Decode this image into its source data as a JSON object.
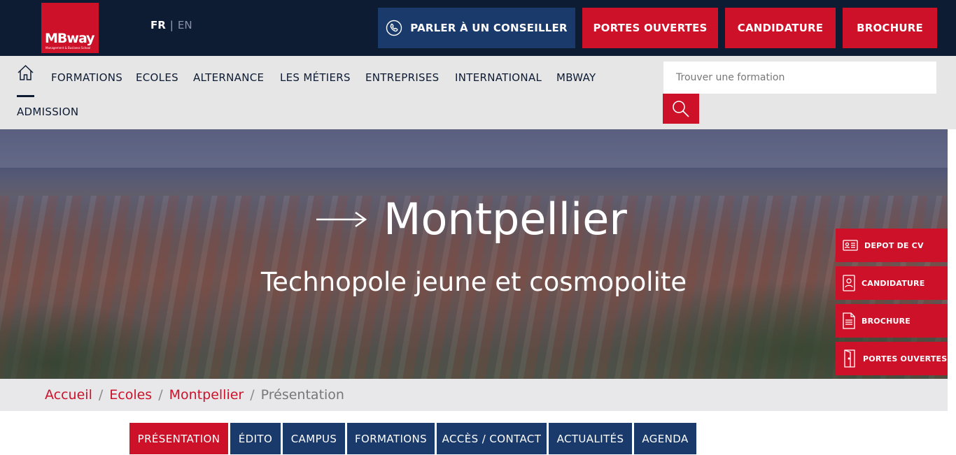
{
  "header": {
    "logo_text": "MBway",
    "logo_tagline": "Management & Business School",
    "lang_fr": "FR",
    "lang_sep": "|",
    "lang_en": "EN",
    "call_label": "PARLER À UN CONSEILLER",
    "open_days_label": "PORTES OUVERTES",
    "application_label": "CANDIDATURE",
    "brochure_label": "BROCHURE"
  },
  "nav": {
    "items": [
      "FORMATIONS",
      "ECOLES",
      "ALTERNANCE",
      "LES MÉTIERS",
      "ENTREPRISES",
      "INTERNATIONAL",
      "MBWAY",
      "ADMISSION"
    ],
    "search_placeholder": "Trouver une formation"
  },
  "hero": {
    "title": "Montpellier",
    "subtitle": "Technopole jeune et cosmopolite"
  },
  "side_actions": [
    "DEPOT DE CV",
    "CANDIDATURE",
    "BROCHURE",
    "PORTES OUVERTES"
  ],
  "breadcrumb": {
    "items": [
      "Accueil",
      "Ecoles",
      "Montpellier"
    ],
    "current": "Présentation",
    "separator": "/"
  },
  "tabs": [
    "PRÉSENTATION",
    "ÉDITO",
    "CAMPUS",
    "FORMATIONS",
    "ACCÈS / CONTACT",
    "ACTUALITÉS",
    "AGENDA"
  ],
  "colors": {
    "brand_red": "#cc1129",
    "navy": "#0d1b33",
    "tab_blue": "#193a6a"
  },
  "icons": {
    "call": "phone-icon",
    "home": "home-icon",
    "search": "search-icon",
    "cv": "id-card-icon",
    "application": "user-document-icon",
    "brochure": "document-icon",
    "open_days": "door-icon",
    "arrow": "arrow-right-icon"
  }
}
